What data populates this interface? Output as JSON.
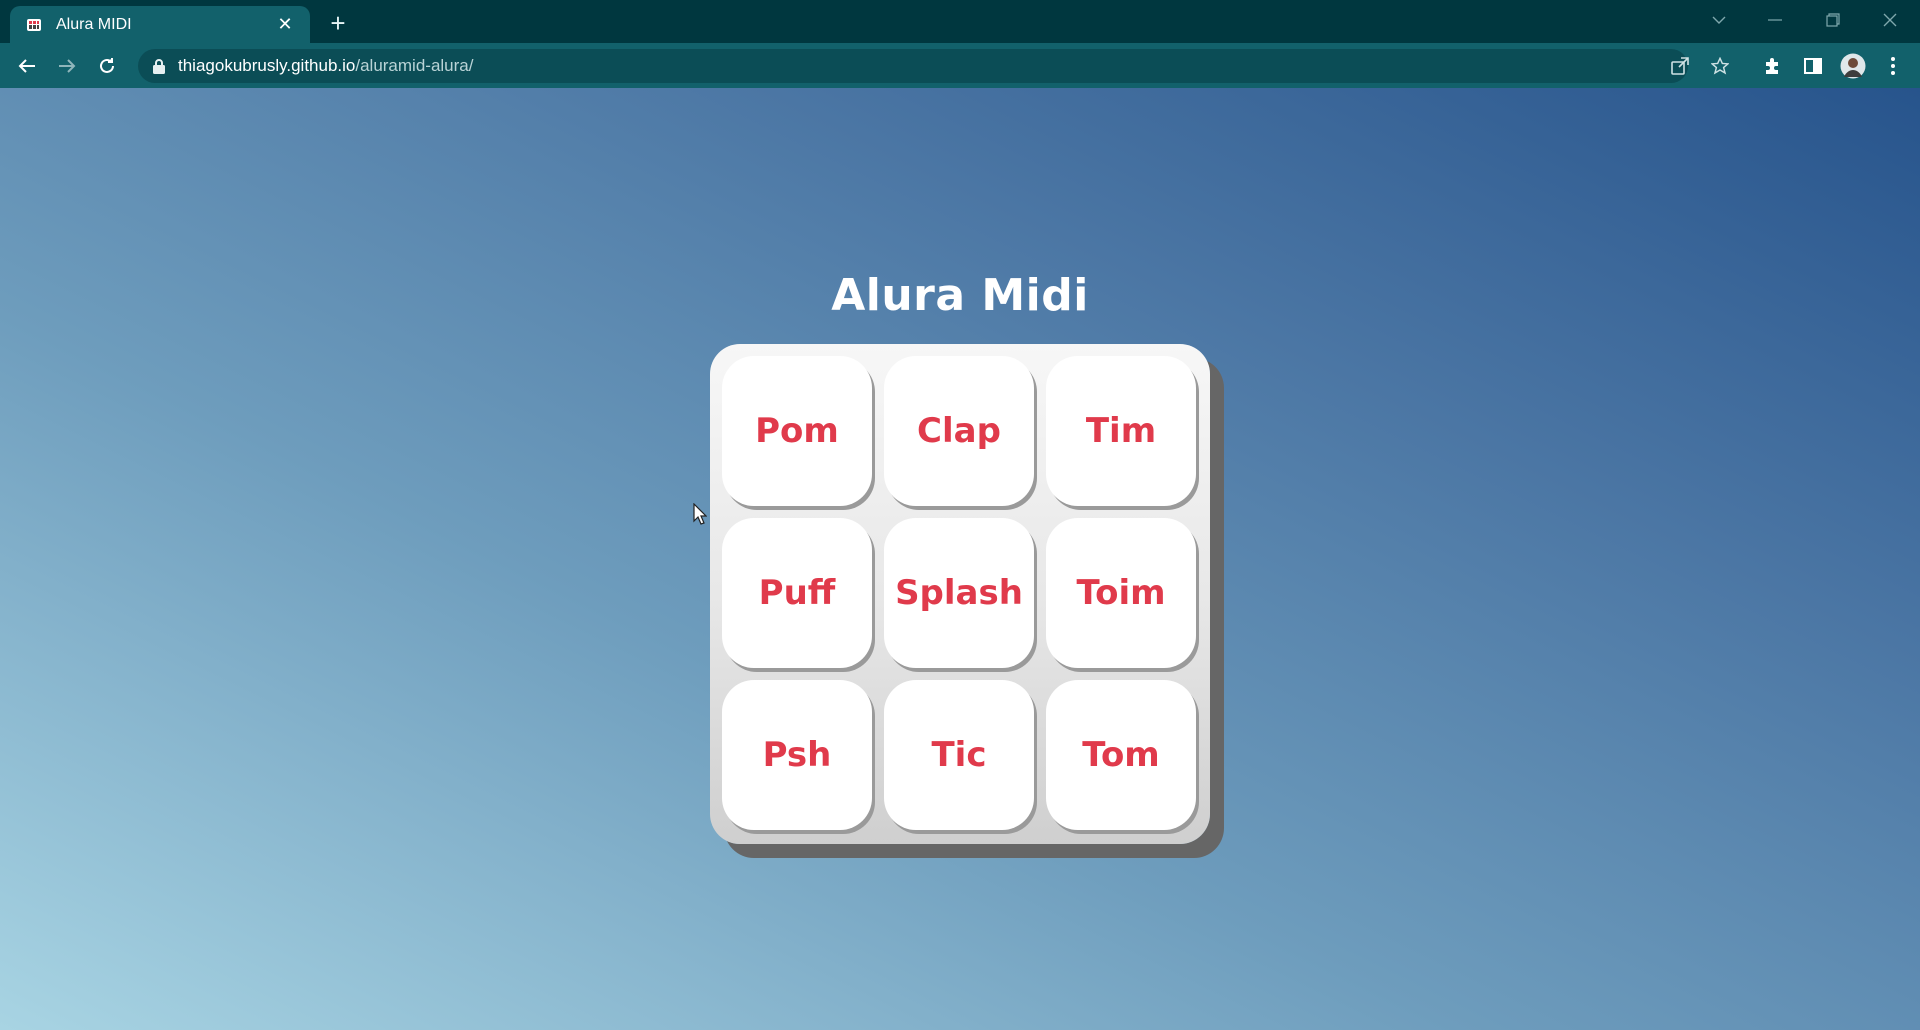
{
  "browser": {
    "tab": {
      "title": "Alura MIDI",
      "close_glyph": "✕"
    },
    "new_tab_glyph": "+",
    "address": {
      "host": "thiagokubrusly.github.io",
      "path": "/aluramid-alura/"
    },
    "colors": {
      "titlebar": "#00373f",
      "toolbar": "#12616b",
      "omnibox": "#0b4d56"
    }
  },
  "app": {
    "title": "Alura Midi",
    "pads": [
      {
        "label": "Pom"
      },
      {
        "label": "Clap"
      },
      {
        "label": "Tim"
      },
      {
        "label": "Puff"
      },
      {
        "label": "Splash"
      },
      {
        "label": "Toim"
      },
      {
        "label": "Psh"
      },
      {
        "label": "Tic"
      },
      {
        "label": "Tom"
      }
    ],
    "colors": {
      "pad_text": "#e03a4b",
      "pad_bg": "#ffffff",
      "keypad_shadow": "#666666"
    }
  }
}
